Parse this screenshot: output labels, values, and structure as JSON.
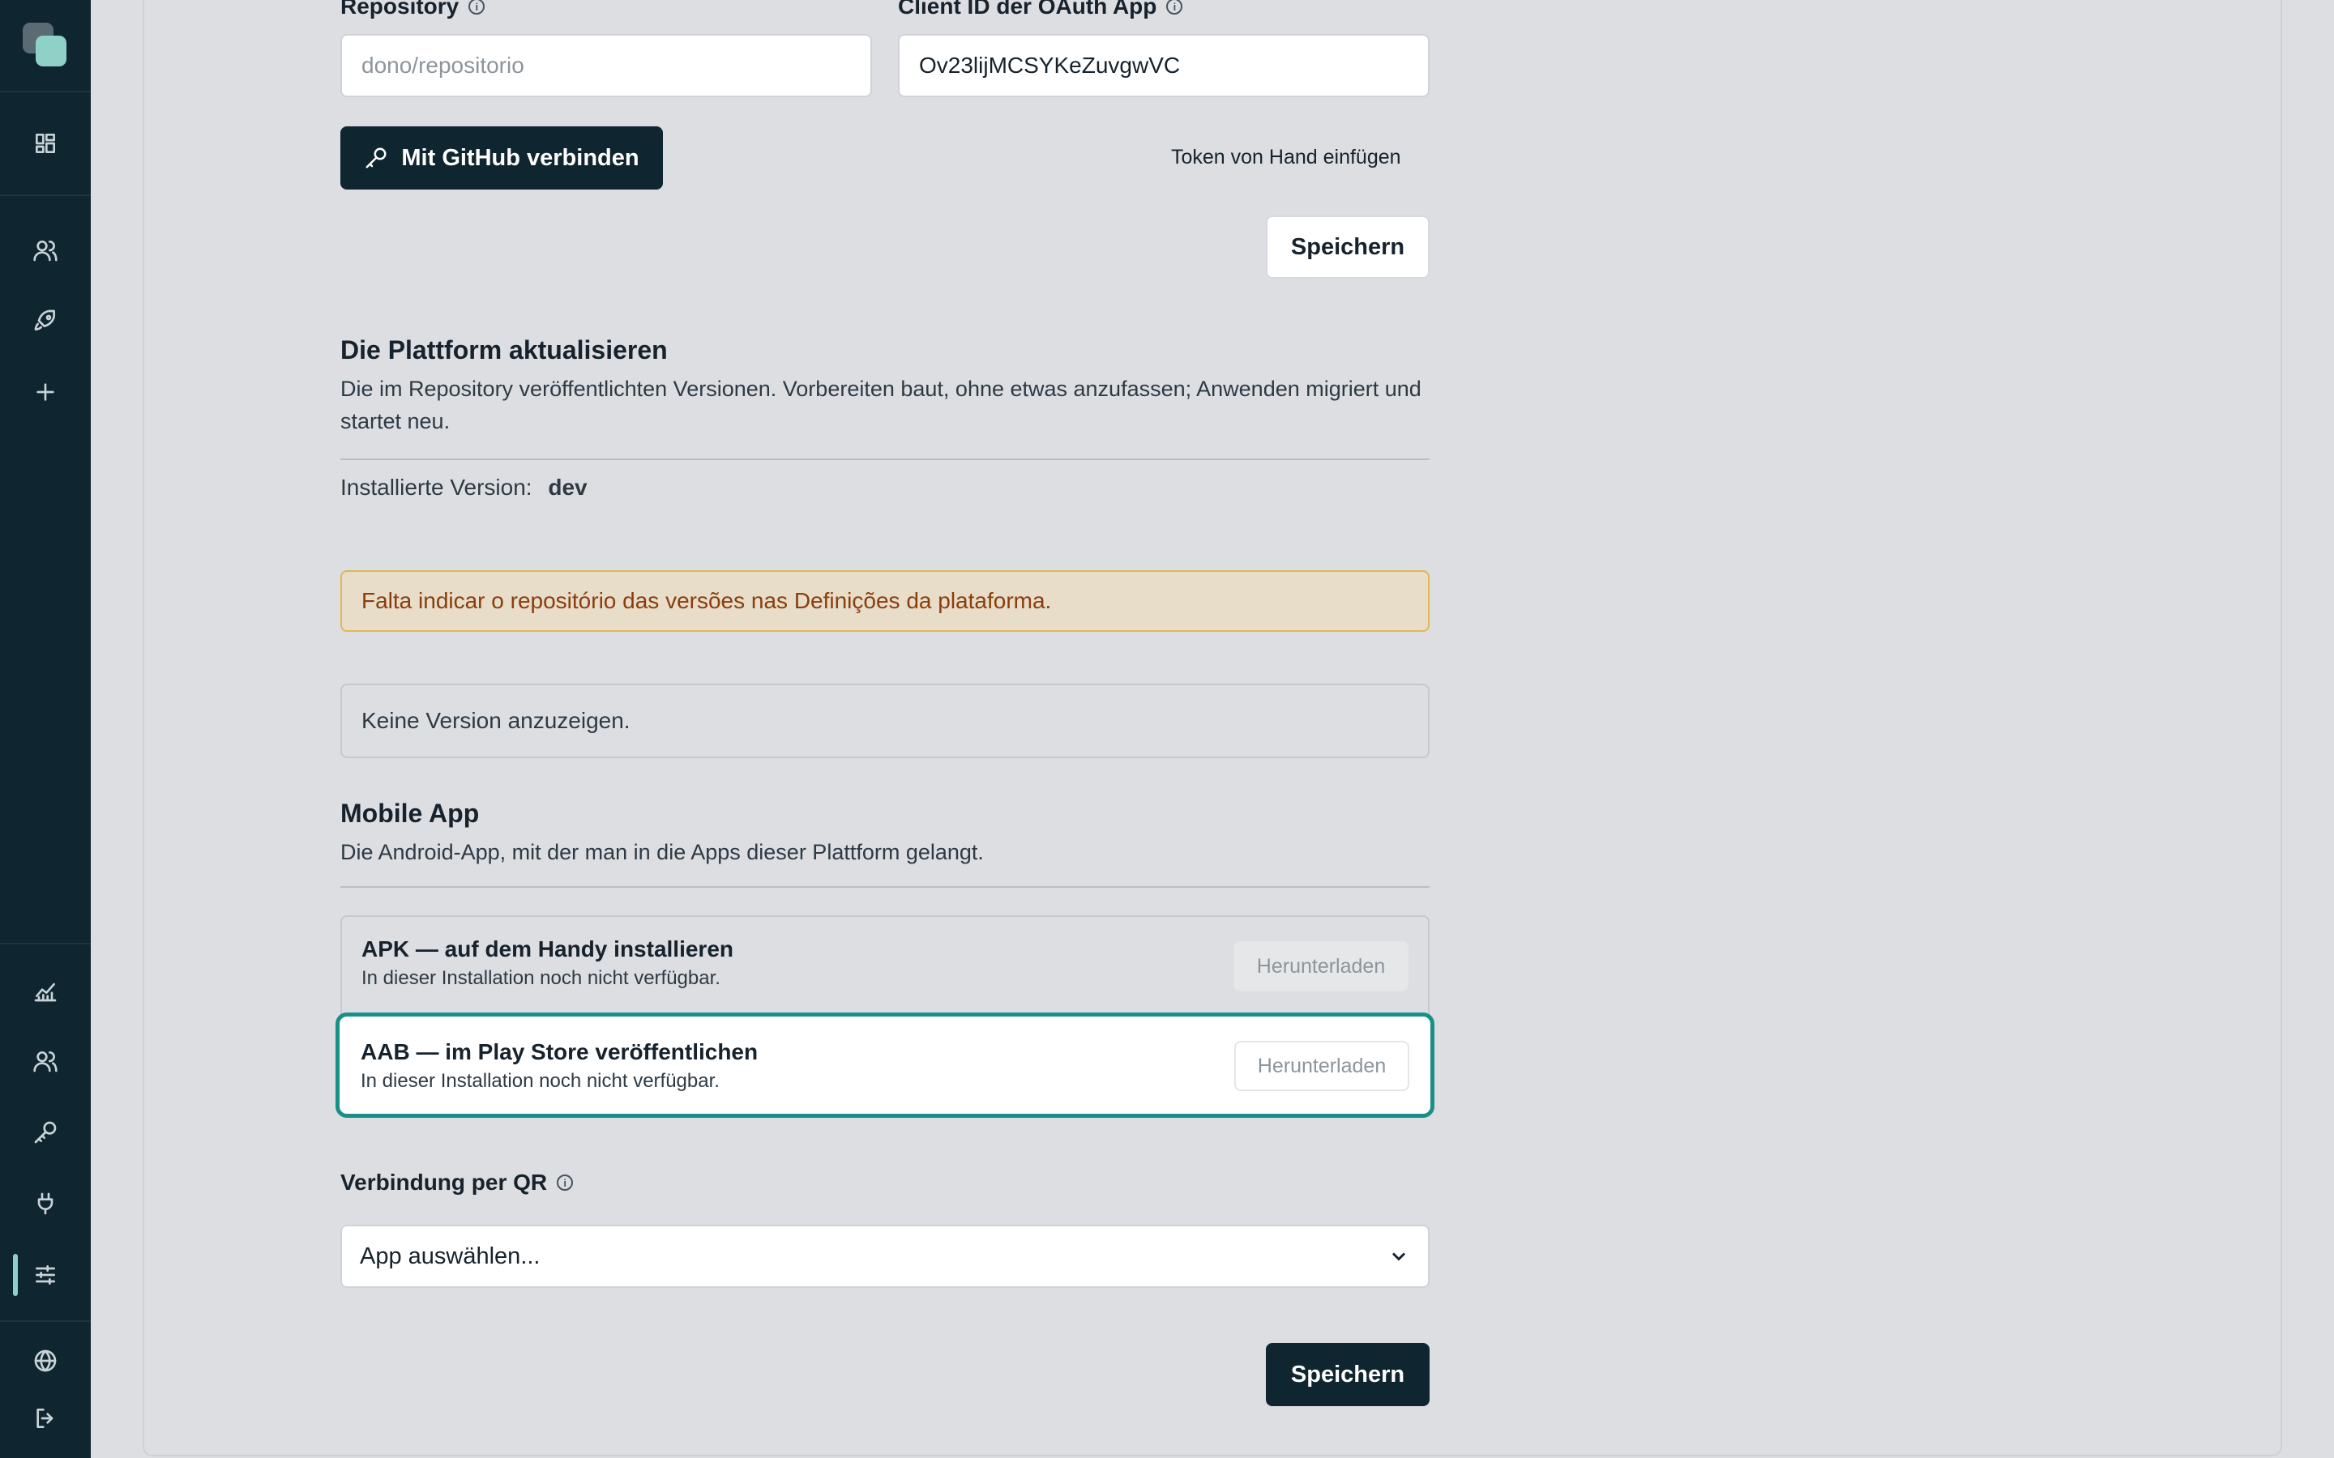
{
  "oauth": {
    "repository_label": "Repository",
    "repository_placeholder": "dono/repositorio",
    "client_id_label": "Client ID der OAuth App",
    "client_id_value": "Ov23lijMCSYKeZuvgwVC",
    "connect_github_label": "Mit GitHub verbinden",
    "paste_token_label": "Token von Hand einfügen",
    "save_label": "Speichern"
  },
  "update": {
    "title": "Die Plattform aktualisieren",
    "description": "Die im Repository veröffentlichten Versionen. Vorbereiten baut, ohne etwas anzufassen; Anwenden migriert und startet neu.",
    "installed_label": "Installierte Version:",
    "installed_value": "dev",
    "alert": "Falta indicar o repositório das versões nas Definições da plataforma.",
    "empty": "Keine Version anzuzeigen."
  },
  "mobile": {
    "title": "Mobile App",
    "description": "Die Android-App, mit der man in die Apps dieser Plattform gelangt.",
    "downloads": [
      {
        "title": "APK — auf dem Handy installieren",
        "subtitle": "In dieser Installation noch nicht verfügbar.",
        "button": "Herunterladen"
      },
      {
        "title": "AAB — im Play Store veröffentlichen",
        "subtitle": "In dieser Installation noch nicht verfügbar.",
        "button": "Herunterladen"
      }
    ],
    "qr_label": "Verbindung per QR",
    "qr_select": "App auswählen...",
    "save_label": "Speichern"
  },
  "colors": {
    "sidebar": "#0f2530",
    "accent": "#8fd1c6",
    "focus_ring": "#1a8f86",
    "alert_text": "#8a3d0d",
    "alert_border": "#e2b653"
  }
}
